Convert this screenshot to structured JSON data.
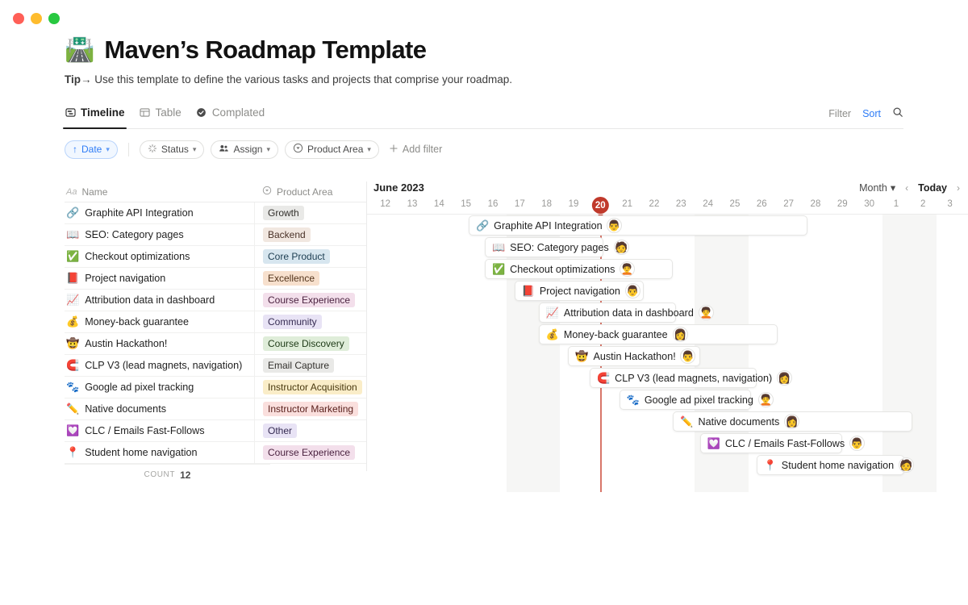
{
  "window": {
    "dots": [
      "close",
      "minimize",
      "zoom"
    ]
  },
  "header": {
    "emoji": "🛣️",
    "title": "Maven’s Roadmap Template",
    "tip_label": "Tip",
    "tip_arrow": "→",
    "tip_text": "Use this template to define the various tasks and projects that comprise your roadmap."
  },
  "tabs": [
    {
      "label": "Timeline",
      "icon": "timeline-icon",
      "active": true
    },
    {
      "label": "Table",
      "icon": "table-icon",
      "active": false
    },
    {
      "label": "Complated",
      "icon": "check-circle-icon",
      "active": false
    }
  ],
  "tabbar_right": {
    "filter": "Filter",
    "sort": "Sort",
    "search_icon": "search-icon"
  },
  "filters": {
    "date": {
      "label": "Date",
      "icon": "arrow-up-icon"
    },
    "pills": [
      {
        "label": "Status",
        "icon": "spinner-icon"
      },
      {
        "label": "Assign",
        "icon": "people-icon"
      },
      {
        "label": "Product Area",
        "icon": "select-icon"
      }
    ],
    "add_filter": "Add filter",
    "add_icon": "plus-icon"
  },
  "table": {
    "columns": [
      {
        "label": "Name",
        "icon": "Aa"
      },
      {
        "label": "Product Area",
        "icon": "select-icon"
      }
    ],
    "footer_label": "COUNT",
    "footer_value": "12"
  },
  "timeline": {
    "month_title": "June 2023",
    "zoom_label": "Month",
    "today_label": "Today",
    "prev_icon": "chevron-left-icon",
    "next_icon": "chevron-right-icon",
    "days": [
      {
        "label": "12"
      },
      {
        "label": "13"
      },
      {
        "label": "14"
      },
      {
        "label": "15"
      },
      {
        "label": "16"
      },
      {
        "label": "17",
        "weekend": true
      },
      {
        "label": "18",
        "weekend": true
      },
      {
        "label": "19"
      },
      {
        "label": "20",
        "today": true
      },
      {
        "label": "21"
      },
      {
        "label": "22"
      },
      {
        "label": "23"
      },
      {
        "label": "24",
        "weekend": true
      },
      {
        "label": "25",
        "weekend": true
      },
      {
        "label": "26"
      },
      {
        "label": "27"
      },
      {
        "label": "28"
      },
      {
        "label": "29"
      },
      {
        "label": "30"
      },
      {
        "label": "1",
        "weekend": true
      },
      {
        "label": "2",
        "weekend": true
      },
      {
        "label": "3"
      }
    ]
  },
  "rows": [
    {
      "emoji": "🔗",
      "name": "Graphite API Integration",
      "area": "Growth",
      "tag_bg": "#e9e9e7",
      "tag_fg": "#32302c",
      "start": 3.6,
      "end": 16.2,
      "avatar": "👨",
      "avatar_at": "inside"
    },
    {
      "emoji": "📖",
      "name": "SEO: Category pages",
      "area": "Backend",
      "tag_bg": "#f1e7e0",
      "tag_fg": "#4a3228",
      "start": 4.2,
      "end": 8.6,
      "avatar": "🧑",
      "avatar_at": "outside"
    },
    {
      "emoji": "✅",
      "name": "Checkout optimizations",
      "area": "Core Product",
      "tag_bg": "#d7e6ef",
      "tag_fg": "#1c3d51",
      "start": 4.2,
      "end": 11.2,
      "avatar": "🧑‍🦱",
      "avatar_at": "inside"
    },
    {
      "emoji": "📕",
      "name": "Project navigation",
      "area": "Excellence",
      "tag_bg": "#f7e0cd",
      "tag_fg": "#53341b",
      "start": 5.3,
      "end": 10.1,
      "avatar": "👨",
      "avatar_at": "inside"
    },
    {
      "emoji": "📈",
      "name": "Attribution data in dashboard",
      "area": "Course Experience",
      "tag_bg": "#f3dfeb",
      "tag_fg": "#4b2340",
      "start": 6.2,
      "end": 11.3,
      "avatar": "🧑‍🦱",
      "avatar_at": "outside"
    },
    {
      "emoji": "💰",
      "name": "Money-back guarantee",
      "area": "Community",
      "tag_bg": "#e8e3f5",
      "tag_fg": "#352b52",
      "start": 6.2,
      "end": 15.1,
      "avatar": "👩",
      "avatar_at": "inside"
    },
    {
      "emoji": "🤠",
      "name": "Austin Hackathon!",
      "area": "Course Discovery",
      "tag_bg": "#dfedd9",
      "tag_fg": "#1e3a17",
      "start": 7.3,
      "end": 12.2,
      "avatar": "👨",
      "avatar_at": "inside"
    },
    {
      "emoji": "🧲",
      "name": "CLP V3 (lead magnets, navigation)",
      "area": "Email Capture",
      "tag_bg": "#e9e9e7",
      "tag_fg": "#32302c",
      "start": 8.1,
      "end": 14.3,
      "avatar": "👩",
      "avatar_at": "outside"
    },
    {
      "emoji": "🐾",
      "name": "Google ad pixel tracking",
      "area": "Instructor Acquisition",
      "tag_bg": "#faedc8",
      "tag_fg": "#4a3a10",
      "start": 9.2,
      "end": 14.1,
      "avatar": "🧑‍🦱",
      "avatar_at": "outside"
    },
    {
      "emoji": "✏️",
      "name": "Native documents",
      "area": "Instructor Marketing",
      "tag_bg": "#fadfdd",
      "tag_fg": "#5a211d",
      "start": 11.2,
      "end": 20.1,
      "avatar": "👩",
      "avatar_at": "inside"
    },
    {
      "emoji": "💟",
      "name": "CLC / Emails Fast-Follows",
      "area": "Other",
      "tag_bg": "#e8e3f5",
      "tag_fg": "#352b52",
      "start": 12.2,
      "end": 17.5,
      "avatar": "👨",
      "avatar_at": "outside"
    },
    {
      "emoji": "📍",
      "name": "Student home navigation",
      "area": "Course Experience",
      "tag_bg": "#f3dfeb",
      "tag_fg": "#4b2340",
      "start": 14.3,
      "end": 19.8,
      "avatar": "🧑",
      "avatar_at": "outside"
    }
  ],
  "colors": {
    "accent_blue": "#2e7cf6",
    "today_red": "#c0392b",
    "today_line": "#d8766a",
    "weekend_band": "#f6f6f5",
    "border": "#e6e6e4"
  }
}
